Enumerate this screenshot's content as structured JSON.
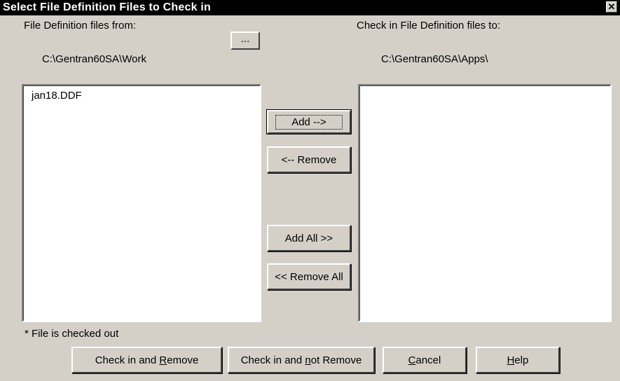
{
  "window": {
    "title": "Select File Definition Files to Check in",
    "close_glyph": "✕"
  },
  "source": {
    "label": "File Definition files from:",
    "path": "C:\\Gentran60SA\\Work",
    "browse_label": "...",
    "items": [
      "jan18.DDF"
    ]
  },
  "destination": {
    "label": "Check in File Definition files to:",
    "path": "C:\\Gentran60SA\\Apps\\",
    "items": []
  },
  "actions": {
    "add": "Add -->",
    "remove": "<-- Remove",
    "add_all": "Add All  >>",
    "remove_all": "<< Remove All"
  },
  "footnote": "* File is checked out",
  "buttons": {
    "check_in_remove_pre": "Check in and ",
    "check_in_remove_key": "R",
    "check_in_remove_post": "emove",
    "check_in_not_remove_pre": "Check in and ",
    "check_in_not_remove_key": "n",
    "check_in_not_remove_post": "ot Remove",
    "cancel_key": "C",
    "cancel_post": "ancel",
    "help_key": "H",
    "help_post": "elp"
  }
}
